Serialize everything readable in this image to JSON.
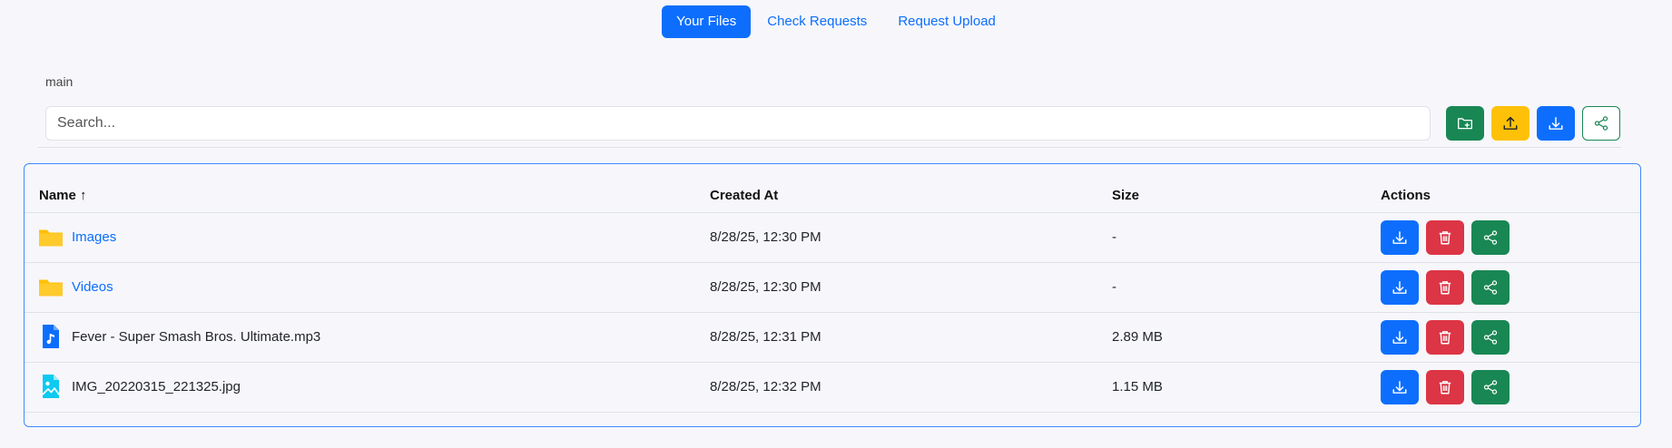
{
  "nav": {
    "tabs": [
      {
        "label": "Your Files",
        "active": true
      },
      {
        "label": "Check Requests",
        "active": false
      },
      {
        "label": "Request Upload",
        "active": false
      }
    ]
  },
  "breadcrumb": {
    "path": "main"
  },
  "search": {
    "placeholder": "Search..."
  },
  "toolbar": {
    "new_folder_icon": "folder-plus-icon",
    "upload_icon": "upload-icon",
    "download_icon": "download-icon",
    "share_icon": "share-icon"
  },
  "table": {
    "columns": {
      "name": "Name ↑",
      "created": "Created At",
      "size": "Size",
      "actions": "Actions"
    },
    "rows": [
      {
        "name": "Images",
        "type": "folder",
        "created": "8/28/25, 12:30 PM",
        "size": "-"
      },
      {
        "name": "Videos",
        "type": "folder",
        "created": "8/28/25, 12:30 PM",
        "size": "-"
      },
      {
        "name": "Fever - Super Smash Bros. Ultimate.mp3",
        "type": "audio",
        "created": "8/28/25, 12:31 PM",
        "size": "2.89 MB"
      },
      {
        "name": "IMG_20220315_221325.jpg",
        "type": "image",
        "created": "8/28/25, 12:32 PM",
        "size": "1.15 MB"
      }
    ]
  },
  "colors": {
    "primary": "#0d6efd",
    "danger": "#dc3545",
    "success": "#198754",
    "warning": "#ffc107",
    "folder": "#ffc107",
    "audio_icon": "#0d6efd",
    "image_icon": "#0dcaf0"
  }
}
